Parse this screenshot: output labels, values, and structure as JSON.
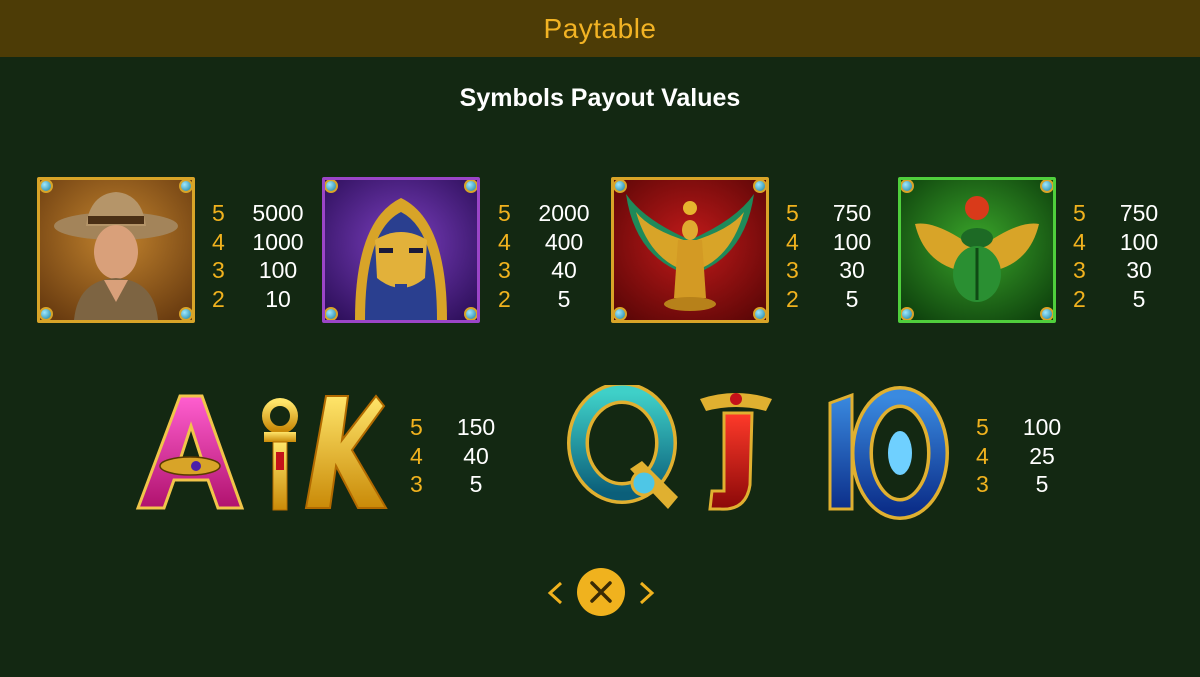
{
  "header": {
    "title": "Paytable"
  },
  "section_title": "Symbols Payout Values",
  "high_symbols": [
    {
      "name": "explorer",
      "payouts": [
        {
          "count": "5",
          "value": "5000"
        },
        {
          "count": "4",
          "value": "1000"
        },
        {
          "count": "3",
          "value": "100"
        },
        {
          "count": "2",
          "value": "10"
        }
      ]
    },
    {
      "name": "pharaoh-mask",
      "payouts": [
        {
          "count": "5",
          "value": "2000"
        },
        {
          "count": "4",
          "value": "400"
        },
        {
          "count": "3",
          "value": "40"
        },
        {
          "count": "2",
          "value": "5"
        }
      ]
    },
    {
      "name": "winged-goddess",
      "payouts": [
        {
          "count": "5",
          "value": "750"
        },
        {
          "count": "4",
          "value": "100"
        },
        {
          "count": "3",
          "value": "30"
        },
        {
          "count": "2",
          "value": "5"
        }
      ]
    },
    {
      "name": "scarab",
      "payouts": [
        {
          "count": "5",
          "value": "750"
        },
        {
          "count": "4",
          "value": "100"
        },
        {
          "count": "3",
          "value": "30"
        },
        {
          "count": "2",
          "value": "5"
        }
      ]
    }
  ],
  "low_symbols": [
    {
      "letters": "AK",
      "payouts": [
        {
          "count": "5",
          "value": "150"
        },
        {
          "count": "4",
          "value": "40"
        },
        {
          "count": "3",
          "value": "5"
        }
      ]
    },
    {
      "letters": "QJ10",
      "payouts": [
        {
          "count": "5",
          "value": "100"
        },
        {
          "count": "4",
          "value": "25"
        },
        {
          "count": "3",
          "value": "5"
        }
      ]
    }
  ],
  "nav": {
    "prev_icon": "chevron-left-icon",
    "close_icon": "close-icon",
    "next_icon": "chevron-right-icon"
  },
  "colors": {
    "background": "#132812",
    "header": "#4d3c06",
    "accent": "#f0b21e"
  }
}
